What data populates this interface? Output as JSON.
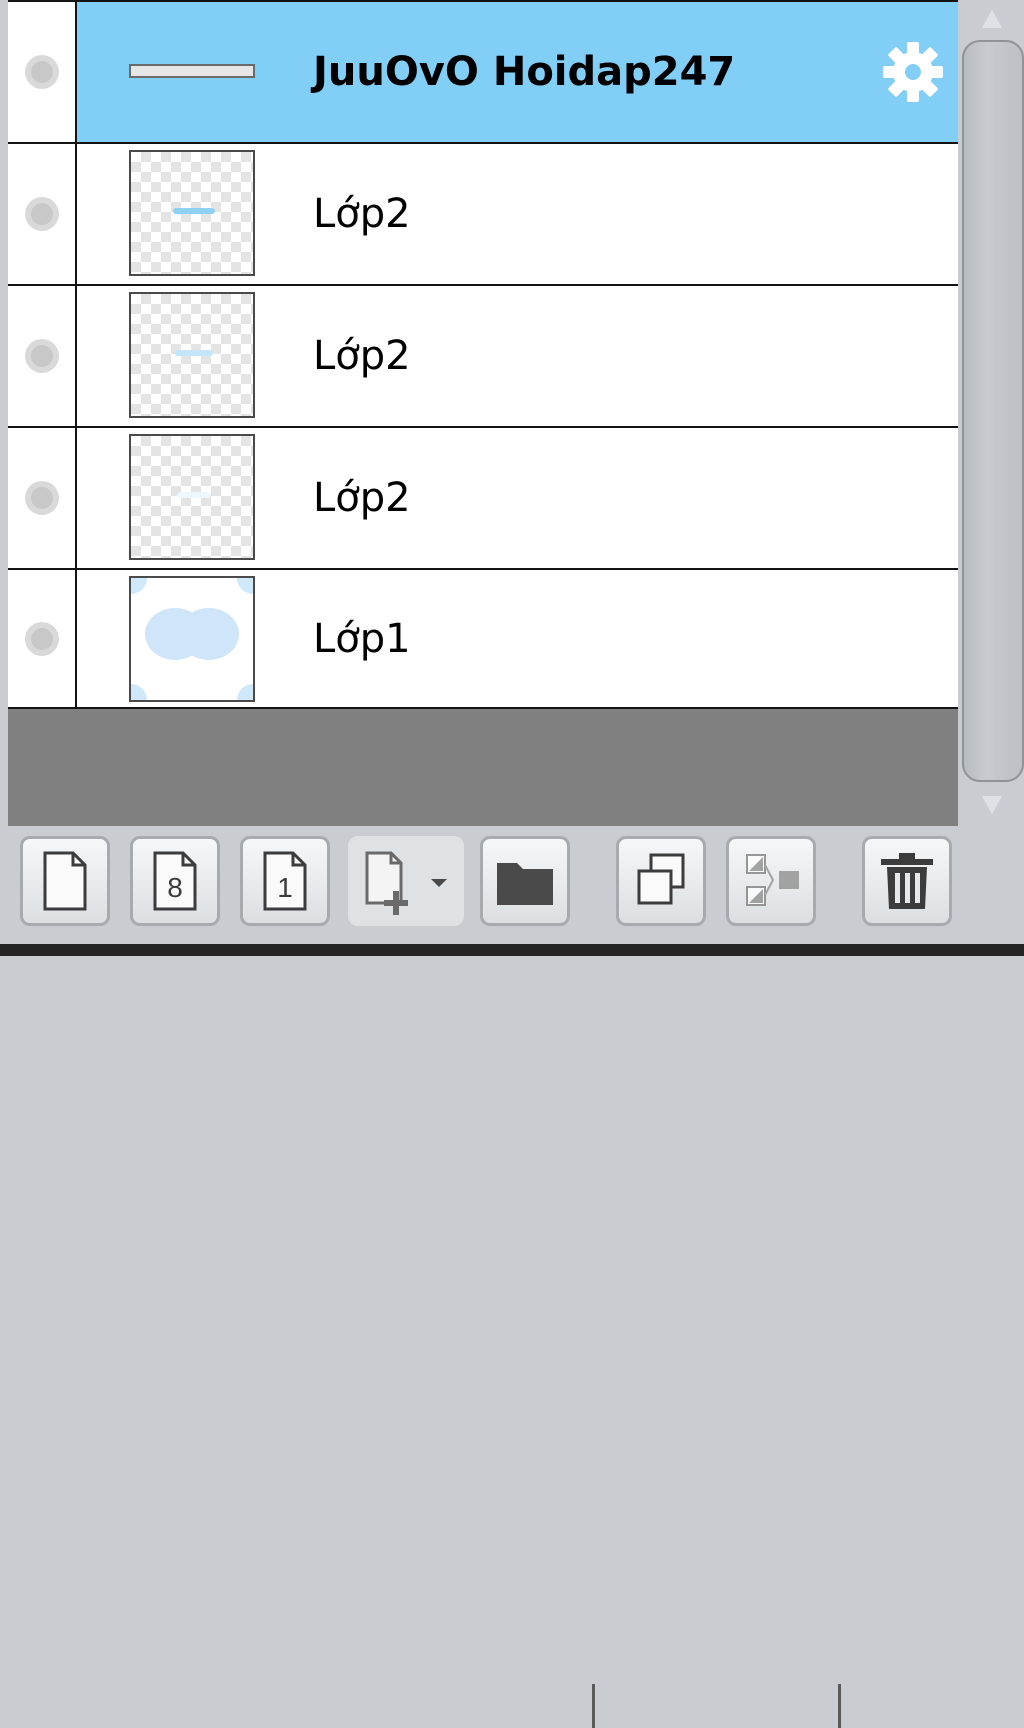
{
  "layers": [
    {
      "name": "JuuOvO Hoidap247",
      "kind": "folder",
      "selected": true,
      "icon": "gear-icon",
      "visible_icon": "visibility-toggle"
    },
    {
      "name": "Lớp2",
      "kind": "raster",
      "selected": false
    },
    {
      "name": "Lớp2",
      "kind": "raster",
      "selected": false
    },
    {
      "name": "Lớp2",
      "kind": "raster",
      "selected": false
    },
    {
      "name": "Lớp1",
      "kind": "raster",
      "selected": false
    }
  ],
  "toolbar": {
    "buttons": [
      {
        "icon": "new-layer-icon"
      },
      {
        "icon": "new-8bit-layer-icon",
        "glyph": "8"
      },
      {
        "icon": "new-1bit-layer-icon",
        "glyph": "1"
      },
      {
        "icon": "add-layer-dropdown-icon"
      },
      {
        "icon": "new-folder-icon"
      },
      {
        "icon": "duplicate-layer-icon"
      },
      {
        "icon": "merge-layer-icon"
      },
      {
        "icon": "delete-layer-icon"
      }
    ]
  },
  "colors": {
    "selected_row": "#81cff7",
    "list_background": "#808080",
    "panel_background": "#c9cdd1"
  }
}
